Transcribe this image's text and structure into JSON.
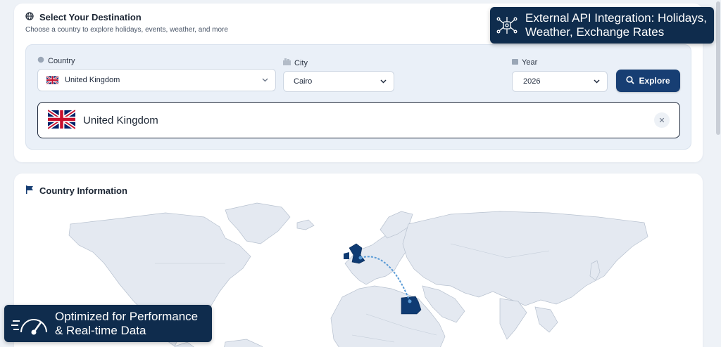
{
  "destination": {
    "title": "Select Your Destination",
    "subtitle": "Choose a country to explore holidays, events, weather, and more",
    "country_label": "Country",
    "country_value": "United Kingdom",
    "city_label": "City",
    "city_value": "Cairo",
    "year_label": "Year",
    "year_value": "2026",
    "explore_label": "Explore",
    "selected_country": "United Kingdom"
  },
  "info": {
    "title": "Country Information"
  },
  "badges": {
    "api_line1": "External API Integration: Holidays,",
    "api_line2": "Weather, Exchange Rates",
    "perf_line1": "Optimized for Performance",
    "perf_line2": "& Real-time Data"
  },
  "map": {
    "origin_country": "United Kingdom",
    "destination_country": "Egypt",
    "highlight_color": "#0f3b73",
    "land_color": "#e4e9f1",
    "route_color": "#5a9bd6"
  },
  "colors": {
    "primary": "#173e73",
    "badge_bg": "#0f2c4d",
    "page_bg": "#eef2f7"
  },
  "icons": {
    "globe": "globe-icon",
    "city": "building-icon",
    "calendar": "calendar-icon",
    "search": "search-icon",
    "flag": "flag-icon",
    "close": "close-icon",
    "network": "network-icon",
    "speed": "speedometer-icon"
  }
}
